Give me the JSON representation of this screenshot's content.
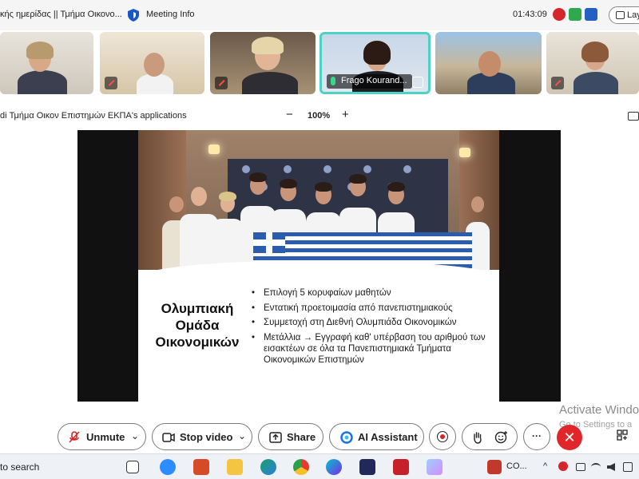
{
  "window": {
    "title": "κής ημερίδας || Τμήμα Οικονο...",
    "meeting_info": "Meeting Info",
    "clock": "01:43:09",
    "layout_label": "Layo"
  },
  "participants": [
    {
      "id": "p1",
      "muted": true
    },
    {
      "id": "p2",
      "muted": true
    },
    {
      "id": "p3",
      "muted": true
    },
    {
      "id": "p4",
      "muted": false,
      "active_speaker": true,
      "name": "Frago Kourand..."
    },
    {
      "id": "p5",
      "muted": true
    },
    {
      "id": "p6",
      "muted": true
    }
  ],
  "share_bar": {
    "app_name": "di Τμήμα Οικον Επιστημών ΕΚΠΑ's applications",
    "zoom_minus": "−",
    "zoom_level": "100%",
    "zoom_plus": "+"
  },
  "slide": {
    "title": "Ολυμπιακή Ομάδα Οικονομικών",
    "bullets": [
      "Επιλογή 5 κορυφαίων μαθητών",
      "Εντατική προετοιμασία από πανεπιστημιακούς",
      "Συμμετοχή στη Διεθνή Ολυμπιάδα Οικονομικών",
      "Μετάλλια → Εγγραφή καθ' υπέρβαση του αριθμού των εισακτέων σε όλα τα Πανεπιστημιακά Τμήματα Οικονομικών Επιστημών"
    ]
  },
  "controls": {
    "unmute": "Unmute",
    "stop_video": "Stop video",
    "share": "Share",
    "ai_assistant": "AI Assistant",
    "chevron": "⌄",
    "more": "···",
    "leave": "✕"
  },
  "watermark": {
    "line1": "Activate Windo",
    "line2": "Go to Settings to a"
  },
  "taskbar": {
    "search": "to search",
    "app_label": "CO...",
    "chevron_up": "^"
  },
  "colors": {
    "accent_teal": "#4fd1c5",
    "leave_red": "#e0262b",
    "greek_blue": "#2b5cae"
  }
}
